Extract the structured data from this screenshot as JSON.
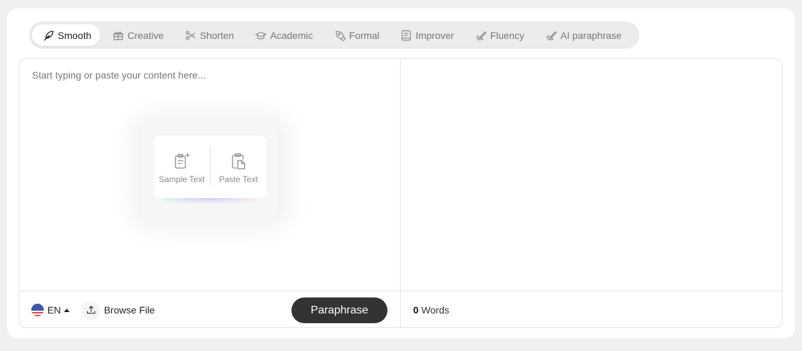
{
  "modes": [
    {
      "label": "Smooth",
      "icon": "feather-icon",
      "active": true
    },
    {
      "label": "Creative",
      "icon": "gift-icon",
      "active": false
    },
    {
      "label": "Shorten",
      "icon": "scissors-icon",
      "active": false
    },
    {
      "label": "Academic",
      "icon": "graduation-cap-icon",
      "active": false
    },
    {
      "label": "Formal",
      "icon": "pen-nib-icon",
      "active": false
    },
    {
      "label": "Improver",
      "icon": "book-icon",
      "active": false
    },
    {
      "label": "Fluency",
      "icon": "signature-pen-icon",
      "active": false
    },
    {
      "label": "AI paraphrase",
      "icon": "signature-pen-icon",
      "active": false
    }
  ],
  "editor": {
    "input_placeholder": "Start typing or paste your content here...",
    "input_value": "",
    "quick_actions": {
      "sample_text": "Sample Text",
      "paste_text": "Paste Text"
    }
  },
  "footer": {
    "language": "EN",
    "browse_file": "Browse File",
    "paraphrase_button": "Paraphrase",
    "word_count": "0",
    "word_label": "Words"
  },
  "colors": {
    "primary_button": "#333333",
    "background": "#f0f0f0",
    "card": "#ffffff"
  }
}
